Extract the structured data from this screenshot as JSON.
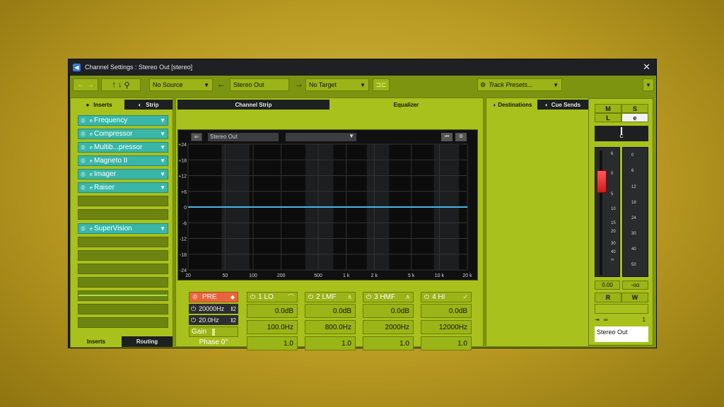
{
  "window": {
    "title": "Channel Settings : Stereo Out [stereo]"
  },
  "toolbar": {
    "source": "No Source",
    "channel_name": "Stereo Out",
    "target": "No Target",
    "presets": "Track Presets..."
  },
  "tabs": {
    "inserts": "Inserts",
    "strip": "Strip",
    "channel_strip": "Channel Strip",
    "equalizer": "Equalizer",
    "destinations": "Destinations",
    "cue_sends": "Cue Sends",
    "bottom_inserts": "Inserts",
    "bottom_routing": "Routing"
  },
  "inserts": [
    "Frequency",
    "Compressor",
    "Multib...pressor",
    "Magneto II",
    "Imager",
    "Raiser"
  ],
  "post_inserts": [
    "SuperVision"
  ],
  "eq": {
    "channel": "Stereo Out",
    "y_labels": [
      "+24",
      "+18",
      "+12",
      "+6",
      "0",
      "-6",
      "-12",
      "-18",
      "-24"
    ],
    "x_labels": [
      "20",
      "50",
      "100",
      "200",
      "500",
      "1 k",
      "2 k",
      "5 k",
      "10 k",
      "20 k"
    ],
    "pre_label": "PRE",
    "hpf": "20000Hz",
    "lpf": "20.0Hz",
    "gain_label": "Gain",
    "phase_label": "Phase 0°",
    "bands": [
      {
        "name": "1 LO",
        "gain": "0.0dB",
        "freq": "100.0Hz",
        "q": "1.0"
      },
      {
        "name": "2 LMF",
        "gain": "0.0dB",
        "freq": "800.0Hz",
        "q": "1.0"
      },
      {
        "name": "3 HMF",
        "gain": "0.0dB",
        "freq": "2000Hz",
        "q": "1.0"
      },
      {
        "name": "4 HI",
        "gain": "0.0dB",
        "freq": "12000Hz",
        "q": "1.0"
      }
    ]
  },
  "mixer": {
    "m": "M",
    "s": "S",
    "l": "L",
    "e": "e",
    "r": "R",
    "w": "W",
    "pan": "C",
    "fader_scale": [
      "6",
      "0",
      "5",
      "10",
      "15",
      "20",
      "30",
      "40",
      "∞"
    ],
    "meter_scale": [
      "0",
      "6",
      "12",
      "18",
      "24",
      "30",
      "40",
      "50"
    ],
    "level_left": "0.00",
    "level_right": "-oo",
    "route_count": "1",
    "output": "Stereo Out"
  },
  "colors": {
    "accent": "#a8c11c",
    "insert": "#39b6a8",
    "pre": "#e8643c",
    "eq_line": "#4ab8e8"
  }
}
